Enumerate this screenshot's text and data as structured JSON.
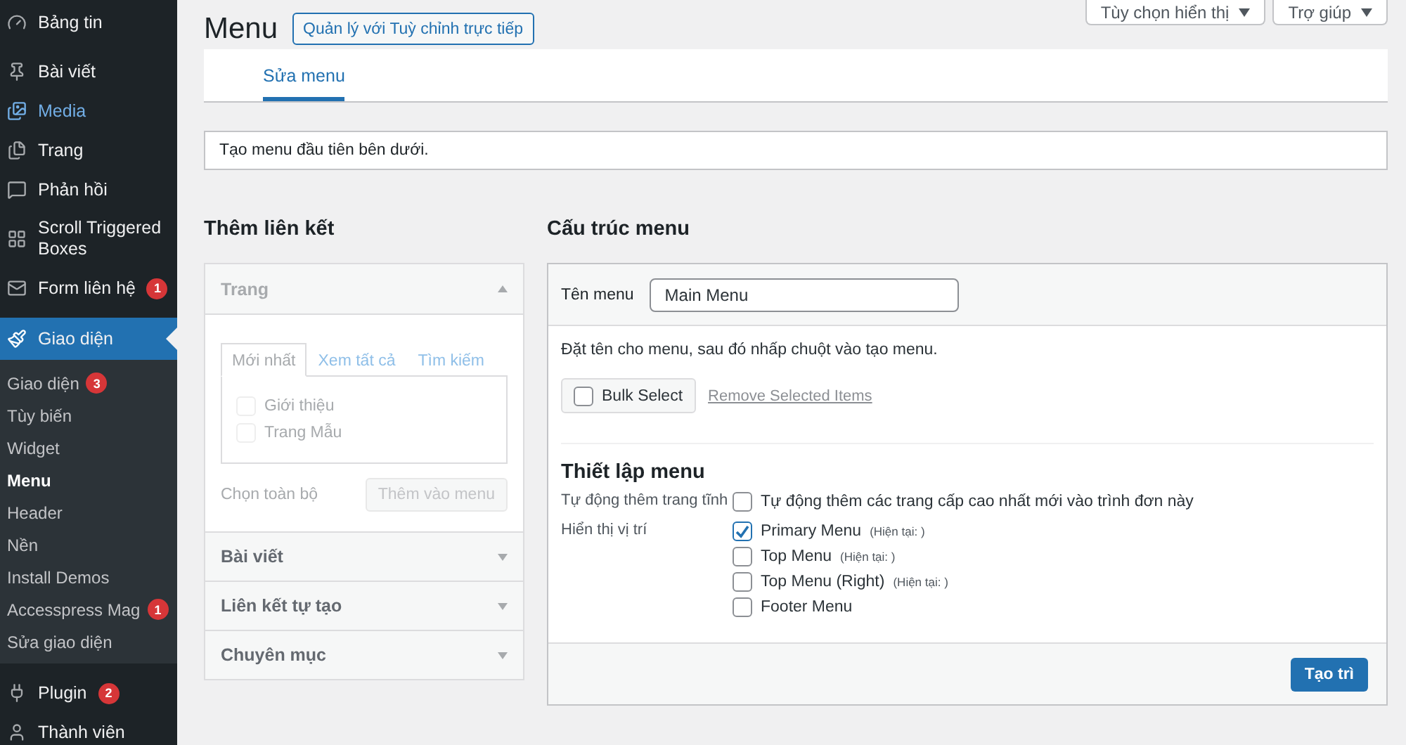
{
  "sidebar": {
    "items": [
      {
        "label": "Bảng tin",
        "selected": false,
        "highlighted": false
      },
      {
        "label": "Bài viết",
        "selected": false,
        "highlighted": false
      },
      {
        "label": "Media",
        "selected": false,
        "highlighted": true
      },
      {
        "label": "Trang",
        "selected": false,
        "highlighted": false
      },
      {
        "label": "Phản hồi",
        "selected": false,
        "highlighted": false
      },
      {
        "label": "Scroll Triggered Boxes",
        "selected": false,
        "highlighted": false
      },
      {
        "label": "Form liên hệ",
        "badge": "1",
        "selected": false,
        "highlighted": false
      },
      {
        "label": "Giao diện",
        "selected": true,
        "highlighted": false,
        "children": [
          {
            "label": "Giao diện",
            "badge": "3",
            "selected": false
          },
          {
            "label": "Tùy biến",
            "selected": false
          },
          {
            "label": "Widget",
            "selected": false
          },
          {
            "label": "Menu",
            "selected": true
          },
          {
            "label": "Header",
            "selected": false
          },
          {
            "label": "Nền",
            "selected": false
          },
          {
            "label": "Install Demos",
            "selected": false
          },
          {
            "label": "Accesspress Mag",
            "badge": "1",
            "selected": false
          },
          {
            "label": "Sửa giao diện",
            "selected": false
          }
        ]
      },
      {
        "label": "Plugin",
        "badge": "2",
        "selected": false,
        "highlighted": false
      },
      {
        "label": "Thành viên",
        "selected": false,
        "highlighted": false
      }
    ]
  },
  "page": {
    "title": "Menu",
    "action_button": "Quản lý với Tuỳ chỉnh trực tiếp"
  },
  "screen_buttons": [
    "Tùy chọn hiển thị",
    "Trợ giúp"
  ],
  "tabs": [
    {
      "label": "Sửa menu",
      "selected": true
    }
  ],
  "notice": "Tạo menu đầu tiên bên dưới.",
  "add_links": {
    "title": "Thêm liên kết",
    "sections": [
      {
        "label": "Trang",
        "expanded": true,
        "disabled": true,
        "tabs": [
          {
            "label": "Mới nhất",
            "selected": true
          },
          {
            "label": "Xem tất cả",
            "selected": false
          },
          {
            "label": "Tìm kiếm",
            "selected": false
          }
        ],
        "items": [
          {
            "label": "Giới thiệu",
            "checked": false
          },
          {
            "label": "Trang Mẫu",
            "checked": false
          }
        ],
        "select_all": "Chọn toàn bộ",
        "add_button": "Thêm vào menu"
      },
      {
        "label": "Bài viết",
        "expanded": false
      },
      {
        "label": "Liên kết tự tạo",
        "expanded": false
      },
      {
        "label": "Chuyên mục",
        "expanded": false
      }
    ]
  },
  "structure": {
    "title": "Cấu trúc menu",
    "name_label": "Tên menu",
    "name_value": "Main Menu",
    "hint": "Đặt tên cho menu, sau đó nhấp chuột vào tạo menu.",
    "bulk_select": {
      "label": "Bulk Select",
      "checked": false
    },
    "remove_link": "Remove Selected Items",
    "settings_title": "Thiết lập menu",
    "auto_add": {
      "label": "Tự động thêm trang tĩnh",
      "option": "Tự động thêm các trang cấp cao nhất mới vào trình đơn này",
      "checked": false
    },
    "locations": {
      "label": "Hiển thị vị trí",
      "items": [
        {
          "label": "Primary Menu",
          "note": "(Hiện tại: )",
          "checked": true
        },
        {
          "label": "Top Menu",
          "note": "(Hiện tại: )",
          "checked": false
        },
        {
          "label": "Top Menu (Right)",
          "note": "(Hiện tại: )",
          "checked": false
        },
        {
          "label": "Footer Menu",
          "checked": false
        }
      ]
    },
    "save_button": "Tạo trì"
  }
}
